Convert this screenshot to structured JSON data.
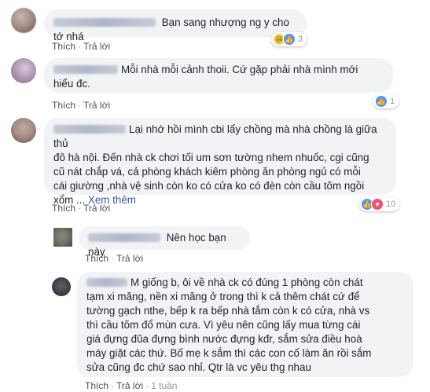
{
  "actions": {
    "like": "Thích",
    "reply": "Trả lời",
    "sep": "·"
  },
  "comments": [
    {
      "text": "Bạn sang nhượng ng y cho tớ nhá",
      "reactions": [
        "haha-icon",
        "like-icon"
      ],
      "count": "3"
    },
    {
      "text_line1": "Mỗi nhà mỗi cảnh thoii. Cứ gặp phải nhà mình mới",
      "text_line2": "hiểu đc.",
      "count": "1"
    },
    {
      "line1": "Lại nhớ hồi mình cbi lấy chồng mà nhà chồng là giữa thủ",
      "line2": "đô hà nội. Đến nhà ck chơi tối um sơn tường nhem nhuốc, cgi cũng",
      "line3": "cũ nát chắp vá, cả phòng khách kiêm phòng ăn phòng ngủ có mỗi",
      "line4": "cái giường ,nhà vệ sinh còn ko có cửa ko có đèn còn cầu tõm ngồi",
      "line5": "xổm ...",
      "more": "Xem thêm",
      "count": "10"
    },
    {
      "text": "Nên học bạn này"
    },
    {
      "line1": "M giống b, ôi về nhà ck có đúng 1 phòng còn chát",
      "line2": "tạm xi măng, nền xi măng ở trong thì k cả thêm chát cứ để",
      "line3": "tường gạch nthe, bếp k ra bếp nhà tắm còn k có cửa, nhà vs",
      "line4": "thì cầu tõm đổ mùn cưa. Vì yêu nên cũng lấy mua từng cái",
      "line5": "giá đựng đũa đựng bình nước đựng kđr, sắm sửa điều hoà",
      "line6": "máy giặt các thứ. Bố mẹ k sắm thì các con cố làm ăn rồi sắm",
      "line7": "sửa cũng đc chứ sao nhỉ. Qtr là vc yêu thg nhau",
      "time": "1 tuần"
    }
  ]
}
